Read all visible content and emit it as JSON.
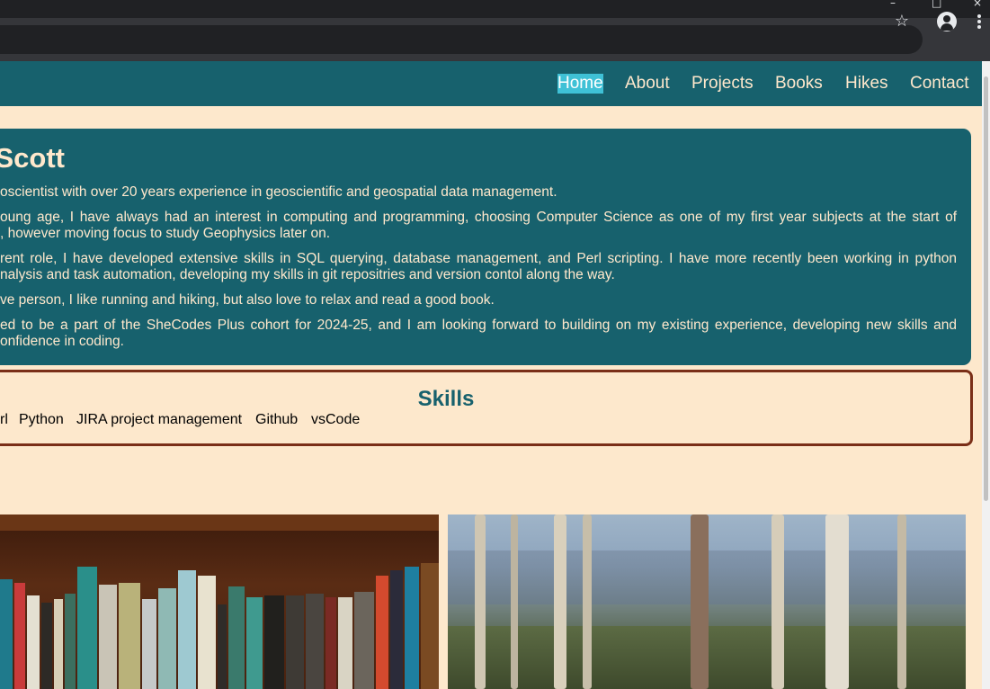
{
  "browser": {
    "window_controls": {
      "minimize": "–",
      "maximize": "□",
      "close": "×"
    },
    "toolbar_icons": [
      "star-icon",
      "profile-icon",
      "menu-icon"
    ]
  },
  "nav": {
    "links": [
      {
        "label": "Home",
        "active": true
      },
      {
        "label": "About",
        "active": false
      },
      {
        "label": "Projects",
        "active": false
      },
      {
        "label": "Books",
        "active": false
      },
      {
        "label": "Hikes",
        "active": false
      },
      {
        "label": "Contact",
        "active": false
      }
    ]
  },
  "intro": {
    "name": "le Scott",
    "paragraphs": [
      [
        "oscientist with over 20 years experience in geoscientific and geospatial data management."
      ],
      [
        "oung age, I have always had an interest in computing and programming, choosing Computer Science as one of my first year subjects at the start of",
        ", however moving focus to study Geophysics later on."
      ],
      [
        "rent role, I have developed extensive skills in SQL querying, database management, and Perl scripting. I have more recently been working in python",
        "nalysis and task automation, developing my skills in git repositries and version contol along the way."
      ],
      [
        "ve person, I like running and hiking, but also love to relax and read a good book."
      ],
      [
        "ed to be a part of the SheCodes Plus cohort for 2024-25, and I am looking forward to building on my existing experience, developing new skills and",
        "onfidence in coding."
      ]
    ]
  },
  "skills": {
    "title": "Skills",
    "items": [
      "rl",
      "Python",
      "JIRA project management",
      "Github",
      "vsCode"
    ]
  },
  "gallery": {
    "photos": [
      "books-photo",
      "hike-photo"
    ]
  },
  "colors": {
    "teal": "#17616d",
    "cream": "#fde8cc",
    "active_highlight": "#3fc1d6",
    "skills_border": "#7a2e17"
  }
}
